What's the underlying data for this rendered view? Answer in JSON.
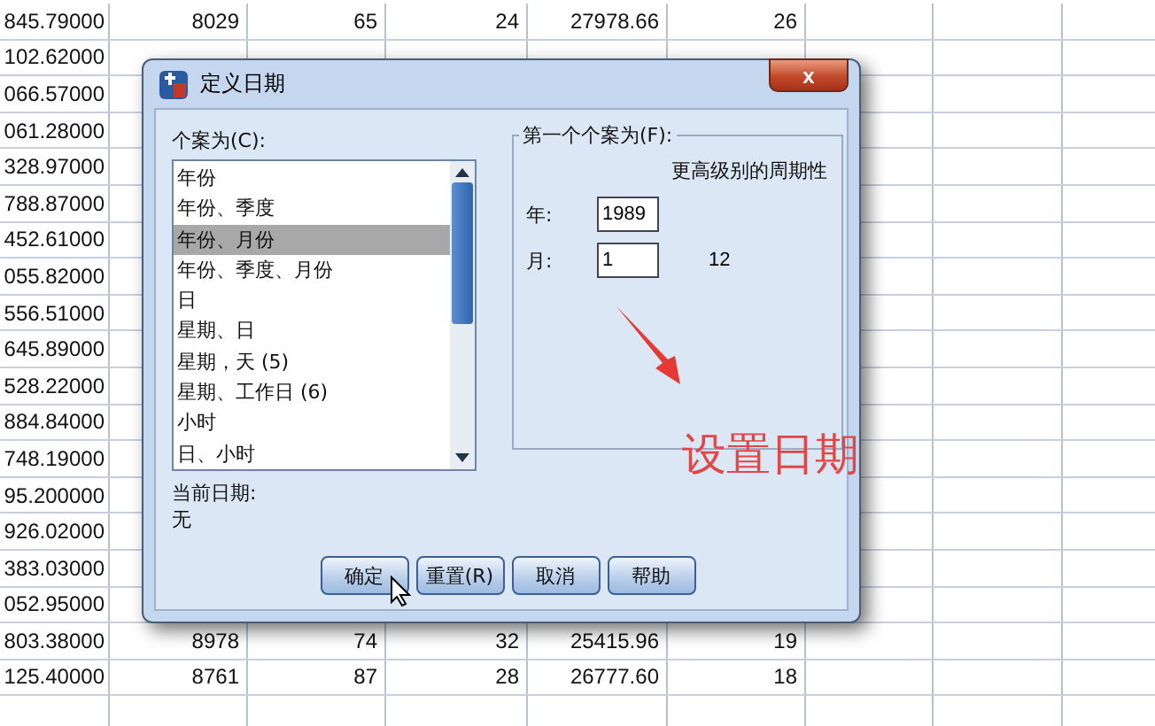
{
  "sheet": {
    "rows": [
      {
        "cells": [
          "845.79000",
          "8029",
          "65",
          "24",
          "27978.66",
          "26"
        ]
      },
      {
        "cells": [
          "102.62000"
        ]
      },
      {
        "cells": [
          "066.57000"
        ]
      },
      {
        "cells": [
          "061.28000"
        ]
      },
      {
        "cells": [
          "328.97000"
        ]
      },
      {
        "cells": [
          "788.87000"
        ]
      },
      {
        "cells": [
          "452.61000"
        ]
      },
      {
        "cells": [
          "055.82000"
        ]
      },
      {
        "cells": [
          "556.51000"
        ]
      },
      {
        "cells": [
          "645.89000"
        ]
      },
      {
        "cells": [
          "528.22000"
        ]
      },
      {
        "cells": [
          "884.84000"
        ]
      },
      {
        "cells": [
          "748.19000"
        ]
      },
      {
        "cells": [
          "95.200000"
        ]
      },
      {
        "cells": [
          "926.02000"
        ]
      },
      {
        "cells": [
          "383.03000"
        ]
      },
      {
        "cells": [
          "052.95000"
        ]
      },
      {
        "cells": [
          "803.38000",
          "8978",
          "74",
          "32",
          "25415.96",
          "19"
        ]
      },
      {
        "cells": [
          "125.40000",
          "8761",
          "87",
          "28",
          "26777.60",
          "18"
        ]
      },
      {
        "cells": []
      }
    ]
  },
  "dialog": {
    "title": "定义日期",
    "close": "x",
    "cases_label": "个案为(C):",
    "cases": [
      {
        "label": "年份",
        "selected": false
      },
      {
        "label": "年份、季度",
        "selected": false
      },
      {
        "label": "年份、月份",
        "selected": true
      },
      {
        "label": "年份、季度、月份",
        "selected": false
      },
      {
        "label": "日",
        "selected": false
      },
      {
        "label": "星期、日",
        "selected": false
      },
      {
        "label": "星期，天 (5)",
        "selected": false
      },
      {
        "label": "星期、工作日 (6)",
        "selected": false
      },
      {
        "label": "小时",
        "selected": false
      },
      {
        "label": "日、小时",
        "selected": false
      }
    ],
    "current_label": "当前日期:",
    "current_value": "无",
    "first_case": {
      "title": "第一个个案为(F):",
      "periodicity_label": "更高级别的周期性",
      "fields": [
        {
          "label": "年:",
          "value": "1989"
        },
        {
          "label": "月:",
          "value": "1",
          "periodicity": "12"
        }
      ]
    },
    "buttons": [
      "确定",
      "重置(R)",
      "取消",
      "帮助"
    ]
  },
  "annotation": {
    "text": "设置日期"
  }
}
